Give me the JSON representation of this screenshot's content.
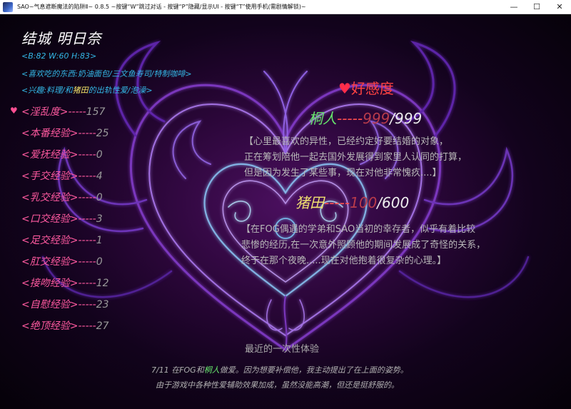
{
  "window": {
    "title": "SAO~气息遮断魔法的陷阱Ⅱ~ 0.8.5 ~按键“W”跳过对话 - 按键“P”隐藏/显示UI - 按键“T”使用手机(需剧情解锁)~",
    "minimize": "—",
    "maximize": "☐",
    "close": "✕"
  },
  "profile": {
    "name": "结城 明日奈",
    "measurements": "<B:82 W:60 H:83>",
    "likes": "<喜欢吃的东西:奶油面包/三文鱼寿司/特制咖啡>",
    "hobbies_prefix": "<兴趣:料理/和",
    "hobbies_highlight": "猪田",
    "hobbies_suffix": "的出轨性爱/泡澡>"
  },
  "stats": [
    {
      "label": "<淫乱度>",
      "value": "157"
    },
    {
      "label": "<本番经验>",
      "value": "25"
    },
    {
      "label": "<爱抚经验>",
      "value": "0"
    },
    {
      "label": "<手交经验>",
      "value": "4"
    },
    {
      "label": "<乳交经验>",
      "value": "0"
    },
    {
      "label": "<口交经验>",
      "value": "3"
    },
    {
      "label": "<足交经验>",
      "value": "1"
    },
    {
      "label": "<肛交经验>",
      "value": "0"
    },
    {
      "label": "<接吻经验>",
      "value": "12"
    },
    {
      "label": "<自慰经验>",
      "value": "23"
    },
    {
      "label": "<绝顶经验>",
      "value": "27"
    }
  ],
  "stat_dash": "-----",
  "affection": {
    "title": "好感度",
    "heart": "♥",
    "kirito": {
      "name": "桐人",
      "dash": "-----",
      "current": "999",
      "max": "/999",
      "desc": [
        "【心里最喜欢的异性，已经约定好要结婚的对象，",
        "正在筹划陪他一起去国外发展得到家里人认同的打算，",
        "但是因为发生了某些事，现在对他非常愧疚....】"
      ]
    },
    "inoda": {
      "name": "猪田",
      "dash": "-----",
      "current": "100",
      "max": "/600",
      "desc": [
        "【在FOG偶遇的学弟和SAO当初的幸存者，似乎有着比较",
        "悲惨的经历,在一次意外照顾他的期间发展成了奇怪的关系，",
        "终于在那个夜晚.....现在对他抱着很复杂的心理。】"
      ]
    }
  },
  "recent": {
    "title": "最近的一次性体验",
    "line1_prefix": "7/11 在FOG和",
    "line1_name": "桐人",
    "line1_suffix": "做爱。因为想要补偿他，我主动提出了在上面的姿势。",
    "line2": "由于游戏中各种性爱辅助效果加成，虽然没能高潮，但还是挺舒服的。"
  },
  "colors": {
    "label_pink": "#ff5aa0",
    "info_cyan": "#34b8e6",
    "kirito_green": "#66e56c",
    "inoda_yellow": "#f0e070",
    "affection_red": "#ff4242"
  }
}
